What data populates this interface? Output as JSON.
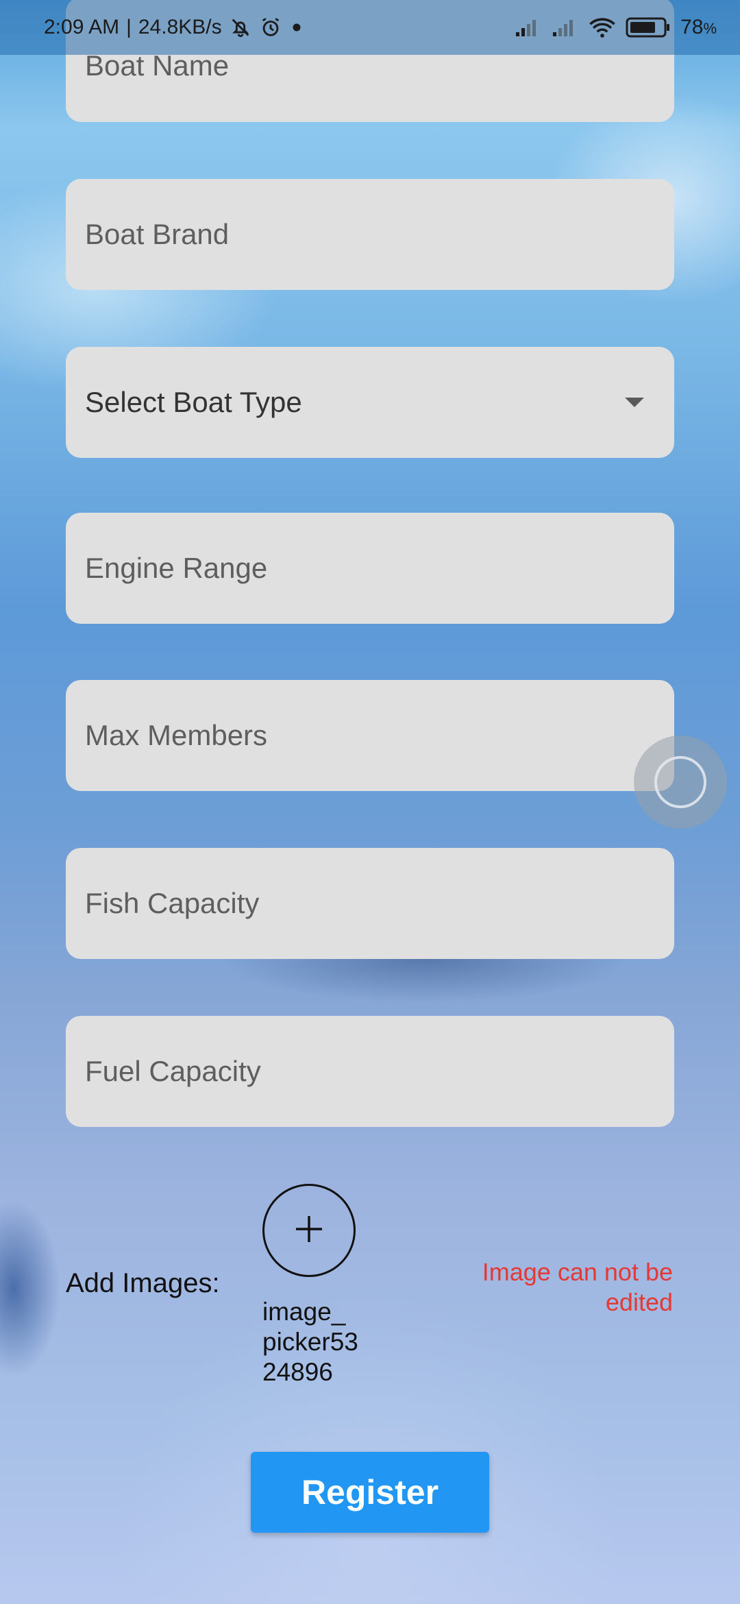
{
  "status_bar": {
    "time": "2:09 AM",
    "network_speed": "24.8KB/s",
    "battery": "78"
  },
  "form": {
    "fields": [
      {
        "placeholder": "Boat Name"
      },
      {
        "placeholder": "Boat Brand"
      },
      {
        "placeholder": "Select Boat Type"
      },
      {
        "placeholder": "Engine Range"
      },
      {
        "placeholder": "Max Members"
      },
      {
        "placeholder": "Fish Capacity"
      },
      {
        "placeholder": "Fuel Capacity"
      }
    ],
    "add_images_label": "Add Images:",
    "image_file_name": "image_picker5324896",
    "error_message": "Image can not be edited",
    "register_label": "Register"
  },
  "colors": {
    "accent": "#2196f3",
    "error": "#e53935",
    "field_bg": "#e0e0e0"
  },
  "icons": [
    "mute-bell-icon",
    "alarm-icon",
    "dot-icon",
    "signal-icon",
    "wifi-icon",
    "battery-icon",
    "plus-icon",
    "dropdown-arrow-icon"
  ]
}
